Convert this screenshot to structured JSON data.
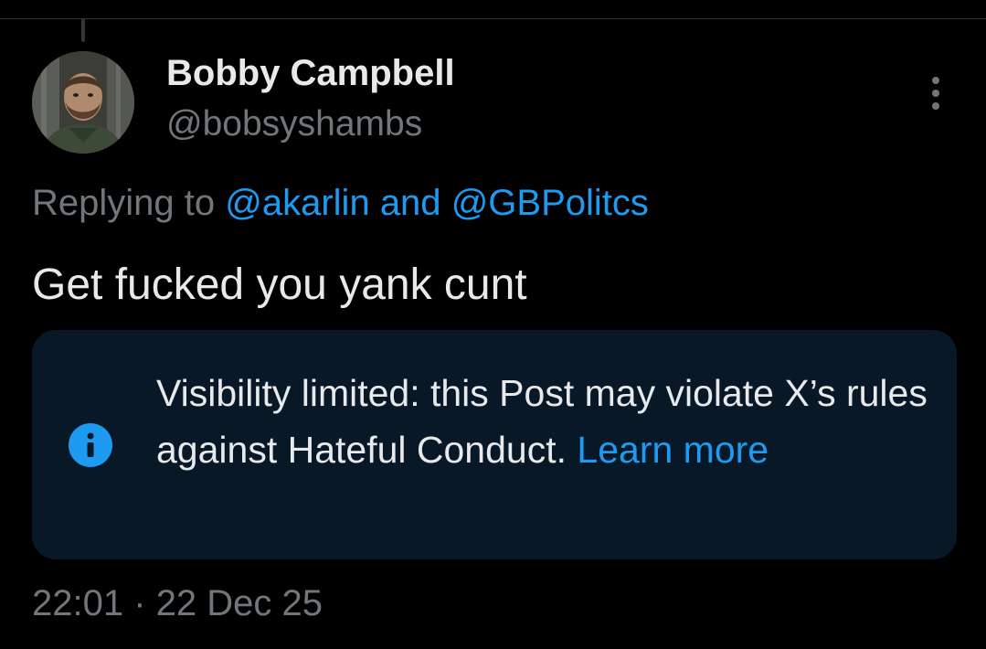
{
  "post": {
    "author": {
      "display_name": "Bobby Campbell",
      "handle": "@bobsyshambs"
    },
    "replying": {
      "prefix": "Replying to",
      "mention_1": "@akarlin",
      "conjunction": "and",
      "mention_2": "@GBPolitcs"
    },
    "text": "Get fucked you yank cunt",
    "notice": {
      "message": "Visibility limited: this Post may violate X’s rules against Hateful Conduct.",
      "link": "Learn more",
      "icon": "info-icon"
    },
    "timestamp": {
      "time": "22:01",
      "separator": "·",
      "date": "22 Dec 25"
    }
  },
  "colors": {
    "background": "#000000",
    "primary_text": "#e7e9ea",
    "secondary_text": "#71767b",
    "accent": "#1d9bf0",
    "notice_background": "#081827"
  }
}
